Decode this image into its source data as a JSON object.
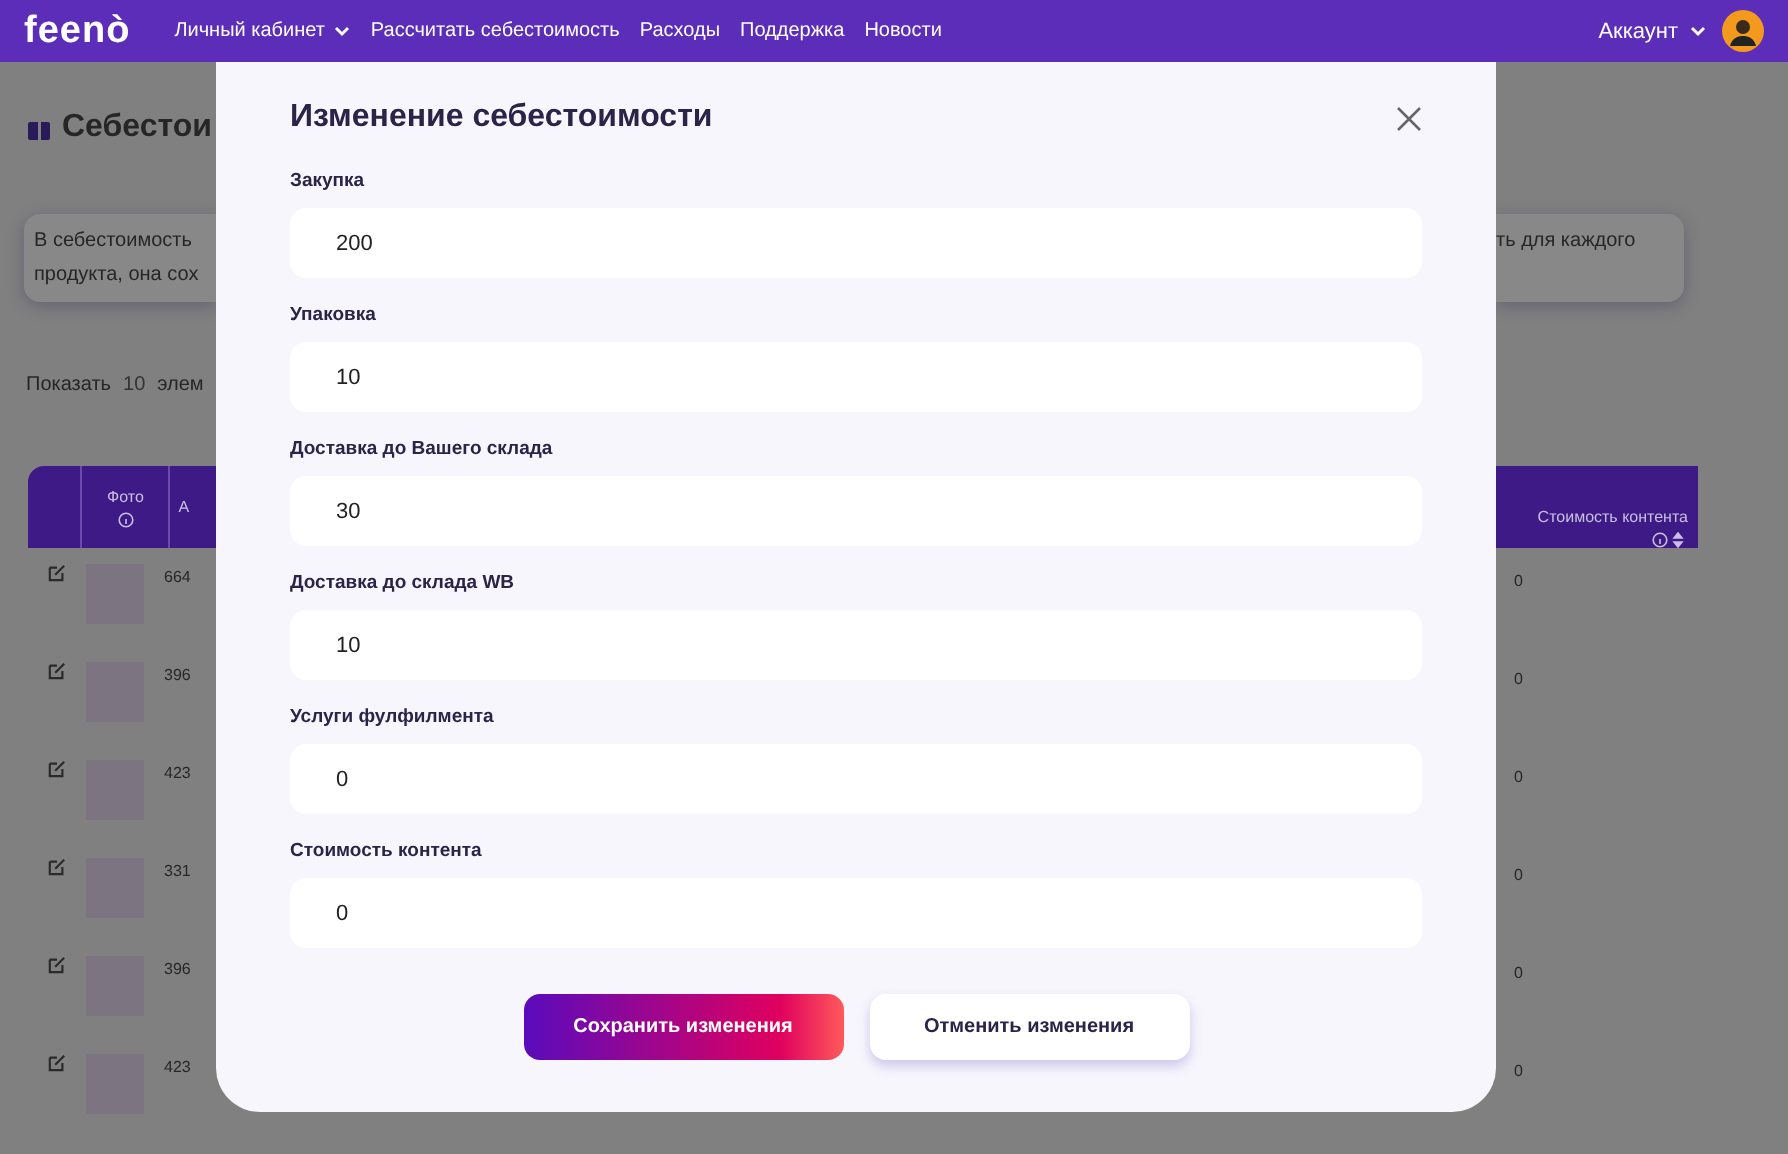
{
  "nav": {
    "logo": "feenò",
    "items": [
      {
        "label": "Личный кабинет",
        "dropdown": true
      },
      {
        "label": "Рассчитать себестоимость",
        "dropdown": false
      },
      {
        "label": "Расходы",
        "dropdown": false
      },
      {
        "label": "Поддержка",
        "dropdown": false
      },
      {
        "label": "Новости",
        "dropdown": false
      }
    ],
    "account": "Аккаунт"
  },
  "page": {
    "title": "Себестои",
    "info_left": [
      "В себестоимость",
      "продукта, она сох"
    ],
    "info_right": "ть для каждого",
    "show_label": "Показать",
    "show_value": "10",
    "show_suffix": "элем",
    "table": {
      "columns": [
        {
          "label": "Фото"
        },
        {
          "label": "А"
        },
        {
          "label": "Стоимость контента"
        }
      ],
      "rows": [
        {
          "article": "664",
          "content_cost": "0"
        },
        {
          "article": "396",
          "content_cost": "0"
        },
        {
          "article": "423",
          "content_cost": "0"
        },
        {
          "article": "331",
          "content_cost": "0"
        },
        {
          "article": "396",
          "content_cost": "0"
        },
        {
          "article": "423",
          "content_cost": "0"
        }
      ]
    }
  },
  "modal": {
    "title": "Изменение себестоимости",
    "fields": [
      {
        "label": "Закупка",
        "value": "200"
      },
      {
        "label": "Упаковка",
        "value": "10"
      },
      {
        "label": "Доставка до Вашего склада",
        "value": "30"
      },
      {
        "label": "Доставка до склада WB",
        "value": "10"
      },
      {
        "label": "Услуги фулфилмента",
        "value": "0"
      },
      {
        "label": "Стоимость контента",
        "value": "0"
      }
    ],
    "save": "Сохранить изменения",
    "cancel": "Отменить изменения"
  }
}
